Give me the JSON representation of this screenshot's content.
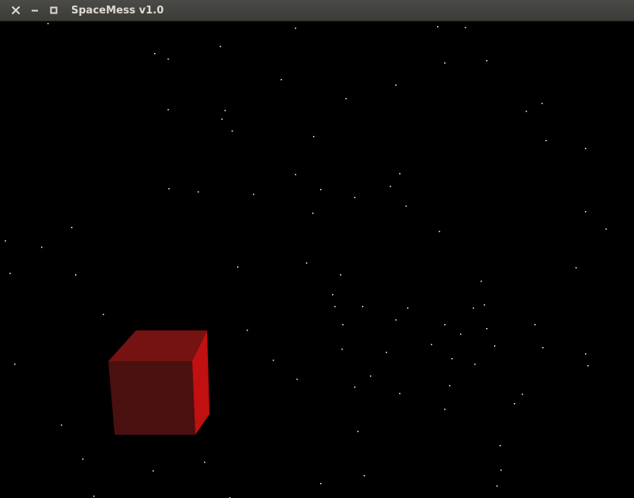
{
  "window": {
    "title": "SpaceMess v1.0",
    "controls": [
      "close-icon",
      "minimize-icon",
      "maximize-icon"
    ]
  },
  "scene": {
    "background_color": "#000000",
    "star_color": "#ffffff",
    "cube": {
      "front_face_color": "#4a1010",
      "top_face_color": "#751212",
      "right_face_color": "#c01010"
    }
  }
}
